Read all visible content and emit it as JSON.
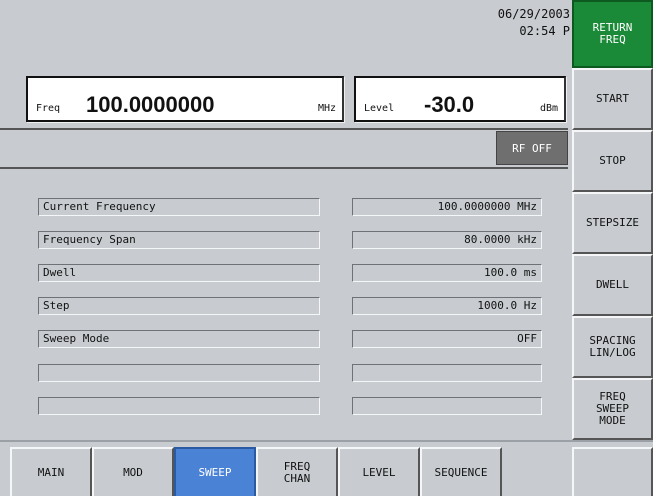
{
  "header": {
    "date": "06/29/2003",
    "time": "02:54 P"
  },
  "freq": {
    "label": "Freq",
    "value": "100.0000000",
    "unit": "MHz"
  },
  "level": {
    "label": "Level",
    "value": "-30.0",
    "unit": "dBm"
  },
  "status": {
    "rf": "RF OFF"
  },
  "table": {
    "rows": [
      {
        "param": "Current Frequency",
        "value": "100.0000000 MHz"
      },
      {
        "param": "Frequency Span",
        "value": "80.0000 kHz"
      },
      {
        "param": "Dwell",
        "value": "100.0 ms"
      },
      {
        "param": "Step",
        "value": "1000.0 Hz"
      },
      {
        "param": "Sweep Mode",
        "value": "OFF"
      },
      {
        "param": "",
        "value": ""
      },
      {
        "param": "",
        "value": ""
      }
    ]
  },
  "softkeys": [
    "RETURN\nFREQ",
    "START",
    "STOP",
    "STEPSIZE",
    "DWELL",
    "SPACING\nLIN/LOG",
    "FREQ\nSWEEP\nMODE"
  ],
  "tabs": [
    "MAIN",
    "MOD",
    "SWEEP",
    "FREQ\nCHAN",
    "LEVEL",
    "SEQUENCE",
    ""
  ],
  "colors": {
    "accent_green": "#1b8a38",
    "tab_active": "#4a82d6",
    "rf_off_bg": "#6f6f6f"
  }
}
